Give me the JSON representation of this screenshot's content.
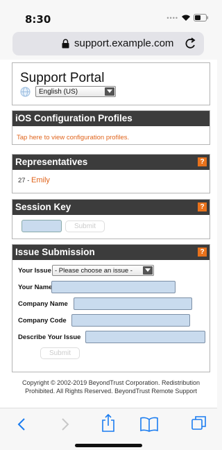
{
  "status_bar": {
    "time": "8:30",
    "signal_icon": "cellular-dots-icon",
    "wifi_icon": "wifi-icon",
    "battery_icon": "battery-icon"
  },
  "address_bar": {
    "url": "support.example.com",
    "lock_icon": "lock-icon",
    "reload_icon": "reload-icon"
  },
  "portal": {
    "title": "Support Portal",
    "language": "English (US)",
    "globe_icon": "globe-icon"
  },
  "ios_profiles": {
    "header": "iOS Configuration Profiles",
    "link": "Tap here to view configuration profiles."
  },
  "representatives": {
    "header": "Representatives",
    "help": "?",
    "items": [
      {
        "prefix": "27 - ",
        "name": "Emily"
      }
    ]
  },
  "session_key": {
    "header": "Session Key",
    "help": "?",
    "input_value": "",
    "submit": "Submit"
  },
  "issue_submission": {
    "header": "Issue Submission",
    "help": "?",
    "issue_label": "Your Issue",
    "issue_select": "- Please choose an issue -",
    "name_label": "Your Name",
    "company_name_label": "Company Name",
    "company_code_label": "Company Code",
    "describe_label": "Describe Your Issue",
    "submit": "Submit"
  },
  "footer": {
    "copyright": "Copyright © 2002-2019 BeyondTrust Corporation. Redistribution Prohibited. All Rights Reserved. BeyondTrust Remote Support"
  },
  "toolbar": {
    "back_icon": "back-icon",
    "forward_icon": "forward-icon",
    "share_icon": "share-icon",
    "bookmarks_icon": "bookmarks-icon",
    "tabs_icon": "tabs-icon"
  },
  "colors": {
    "accent_orange": "#e0641c",
    "header_dark": "#3c3c3c",
    "field_blue": "#c9dbee"
  }
}
